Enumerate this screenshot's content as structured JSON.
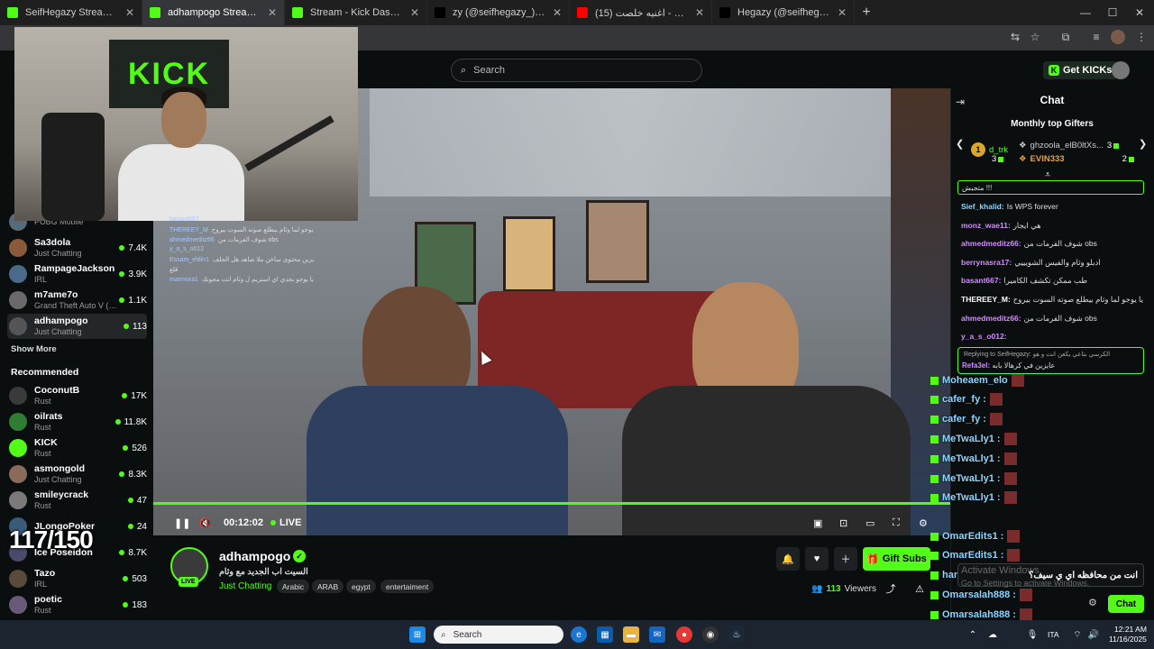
{
  "browser": {
    "tabs": [
      {
        "title": "SeifHegazy Stream - Watch Live",
        "favicon": "kick-icon",
        "color": "#53fc18",
        "active": false
      },
      {
        "title": "adhampogo Stream - Watch Live",
        "favicon": "kick-icon",
        "color": "#53fc18",
        "active": true
      },
      {
        "title": "Stream - Kick Dashboard",
        "favicon": "kick-icon",
        "color": "#53fc18",
        "active": false
      },
      {
        "title": "zy (@seifhegazy_) | TikTok(+99)",
        "favicon": "tiktok-icon",
        "color": "#000000",
        "active": false
      },
      {
        "title": "(15) احمد بتشان - اغنيه خلصت",
        "favicon": "youtube-icon",
        "color": "#ff0000",
        "active": false
      },
      {
        "title": "Hegazy (@seifhegazy_) | TikTok",
        "favicon": "tiktok-icon",
        "color": "#000000",
        "active": false
      }
    ]
  },
  "header": {
    "search_placeholder": "Search",
    "get_kicks": "Get KICKs"
  },
  "sidebar": {
    "following": [
      {
        "name": "",
        "category": "PUBG Mobile",
        "viewers": "",
        "avatar_color": "#556b7a"
      },
      {
        "name": "Sa3dola",
        "category": "Just Chatting",
        "viewers": "7.4K",
        "avatar_color": "#8a5a3a"
      },
      {
        "name": "RampageJackson",
        "category": "IRL",
        "viewers": "3.9K",
        "avatar_color": "#4a6a8a"
      },
      {
        "name": "m7ame7o",
        "category": "Grand Theft Auto V (G...",
        "viewers": "1.1K",
        "avatar_color": "#6a6a6a"
      },
      {
        "name": "adhampogo",
        "category": "Just Chatting",
        "viewers": "113",
        "avatar_color": "#555555"
      }
    ],
    "show_more": "Show More",
    "recommended_title": "Recommended",
    "recommended": [
      {
        "name": "CoconutB",
        "category": "Rust",
        "viewers": "17K",
        "avatar_color": "#3a3a3a"
      },
      {
        "name": "oilrats",
        "category": "Rust",
        "viewers": "11.8K",
        "avatar_color": "#2e7d32"
      },
      {
        "name": "KICK",
        "category": "Rust",
        "viewers": "526",
        "avatar_color": "#53fc18"
      },
      {
        "name": "asmongold",
        "category": "Just Chatting",
        "viewers": "8.3K",
        "avatar_color": "#8a6a5a"
      },
      {
        "name": "smileycrack",
        "category": "Rust",
        "viewers": "47",
        "avatar_color": "#7a7a7a"
      },
      {
        "name": "JLongoPoker",
        "category": "",
        "viewers": "24",
        "avatar_color": "#3a5a7a"
      },
      {
        "name": "Ice Poseidon",
        "category": "",
        "viewers": "8.7K",
        "avatar_color": "#4a4a6a"
      },
      {
        "name": "Tazo",
        "category": "IRL",
        "viewers": "503",
        "avatar_color": "#5a4a3a"
      },
      {
        "name": "poetic",
        "category": "Rust",
        "viewers": "183",
        "avatar_color": "#6a5a7a"
      }
    ],
    "counter": "117/150"
  },
  "video": {
    "time": "00:12:02",
    "live_label": "LIVE",
    "progress": 1.0
  },
  "overlay_chat": [
    {
      "name": "basant667",
      "text": ""
    },
    {
      "name": "THEREEY_M",
      "text": "يا يوجو لما وثام بيطلع صوته السوت بيروح"
    },
    {
      "name": "ahmedmeditz66",
      "text": "شوف الفرمات من obs"
    },
    {
      "name": "y_a_s_o012",
      "text": ""
    },
    {
      "name": "Essam_eldin1",
      "text": "عايزين محتوى ساخن ملا شاهد هل الحلف"
    },
    {
      "name": "",
      "text": "قلع"
    },
    {
      "name": "marmora1",
      "text": "يا يوجو بجدي اي استريم ل وثام انت مجونك"
    }
  ],
  "stream_info": {
    "streamer": "adhampogo",
    "live_badge": "LIVE",
    "title": "السيت اب الجديد مع وثام",
    "category": "Just Chatting",
    "tags": [
      "Arabic",
      "ARAB",
      "egypt",
      "entertaiment"
    ],
    "gift_subs": "Gift Subs",
    "viewers": "113",
    "viewers_label": "Viewers"
  },
  "chat": {
    "title": "Chat",
    "gifters_title": "Monthly top Gifters",
    "gifters": [
      {
        "rank": "1",
        "name": "d_trk",
        "count": "3"
      },
      {
        "name": "ghzoola_elB0ltXs...",
        "count": "3"
      },
      {
        "name": "EVIN333",
        "count": "2"
      }
    ],
    "pinned": "متجبش !!!",
    "messages": [
      {
        "user": "Sief_khalid:",
        "text": "Is WPS forever",
        "color": "#8fd6ff"
      },
      {
        "user": "monz_wae11:",
        "text": "هي ايجار",
        "color": "#d28cff"
      },
      {
        "user": "ahmedmeditz66:",
        "text": "شوف الفرمات من obs",
        "color": "#d28cff"
      },
      {
        "user": "berrynasra17:",
        "text": "ادبلو وثام والفيس الشويييي",
        "color": "#d28cff"
      },
      {
        "user": "basant667:",
        "text": "طب ممكن تكشف الكاميرا",
        "color": "#d28cff"
      },
      {
        "user": "THEREEY_M:",
        "text": "يا يوجو لما وثام بيطلع صوته السوت بيروح",
        "color": "#ffffff"
      },
      {
        "user": "ahmedmeditz66:",
        "text": "شوف الفرمات من obs",
        "color": "#d28cff"
      },
      {
        "user": "y_a_s_o012:",
        "text": "",
        "color": "#d28cff"
      }
    ],
    "reply_to": "Replying to SeifHegazy: الكرسي بتاعي يكعن انت و هو",
    "reply_user": "Refa3el:",
    "reply_text": "عايزين في كرهالا بابه",
    "input_text": "انت من محافظه اي ي سيف؟",
    "send_label": "Chat",
    "watermark1": "Activate Windows",
    "watermark2": "Go to Settings to activate Windows."
  },
  "stream_overlay_chat": [
    "Moheaem_elo",
    "cafer_fy :",
    "cafer_fy :",
    "MeTwaLly1 :",
    "MeTwaLly1 :",
    "MeTwaLly1 :",
    "MeTwaLly1 :",
    "OmarEdits1 :",
    "OmarEdits1 :",
    "hamed2244 :",
    "Omarsalah888 :",
    "Omarsalah888 :"
  ],
  "taskbar": {
    "search": "Search",
    "lang": "ITA",
    "time": "12:21 AM",
    "date": "11/16/2025"
  }
}
